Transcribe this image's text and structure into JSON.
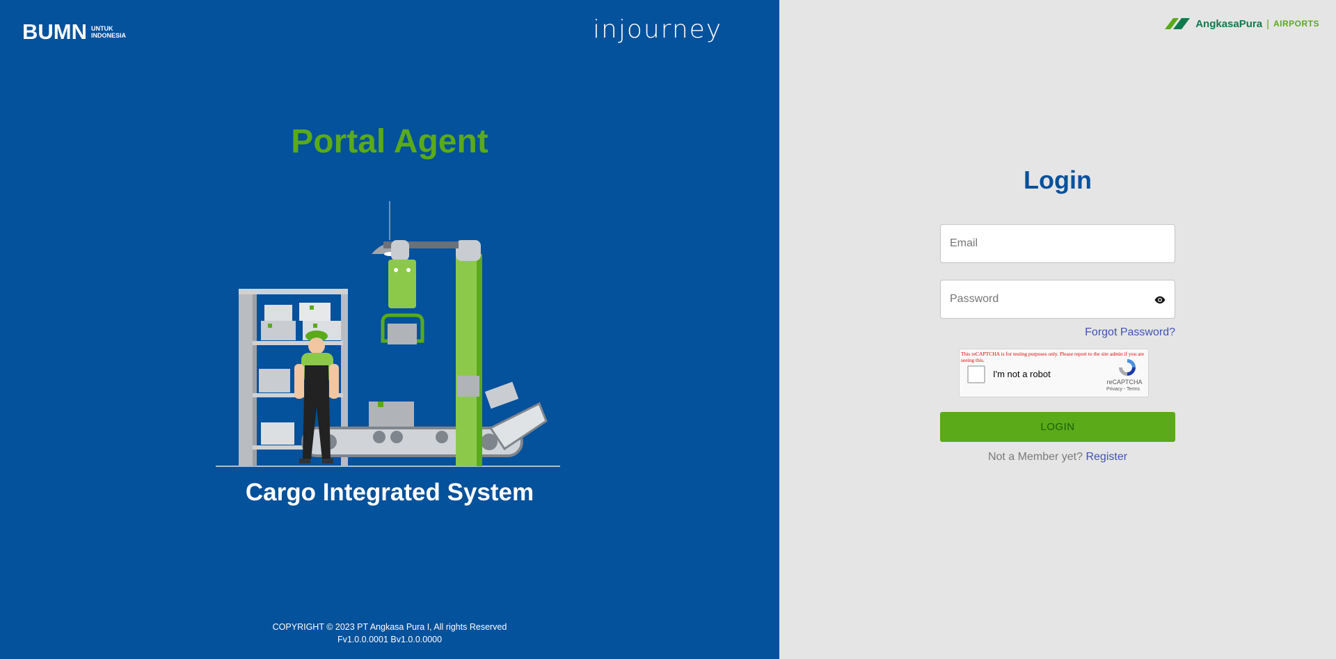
{
  "left": {
    "bumn_logo": {
      "word": "BUMN",
      "sub_line1": "UNTUK",
      "sub_line2": "INDONESIA"
    },
    "injourney_logo": "injourney",
    "portal_title": "Portal Agent",
    "illustration_icon": "warehouse-conveyor-illustration",
    "system_title": "Cargo Integrated System",
    "copyright": "COPYRIGHT © 2023 PT Angkasa Pura I, All rights Reserved",
    "version": "Fv1.0.0.0001 Bv1.0.0.0000"
  },
  "right": {
    "airport_logo": {
      "name": "AngkasaPura",
      "separator": "|",
      "tag": "AIRPORTS"
    },
    "login_title": "Login",
    "email": {
      "placeholder": "Email",
      "value": ""
    },
    "password": {
      "placeholder": "Password",
      "value": "",
      "icon": "eye-icon"
    },
    "forgot_link": "Forgot Password?",
    "recaptcha": {
      "warning": "This reCAPTCHA is for testing purposes only. Please report to the site admin if you are seeing this.",
      "label": "I'm not a robot",
      "brand": "reCAPTCHA",
      "terms": "Privacy - Terms"
    },
    "login_button": "LOGIN",
    "register_prompt": "Not a Member yet?",
    "register_link": "Register"
  },
  "colors": {
    "left_bg": "#04519c",
    "right_bg": "#e5e5e5",
    "accent_green": "#5aaa19",
    "title_blue": "#04519c",
    "link_blue": "#3f51b5"
  }
}
